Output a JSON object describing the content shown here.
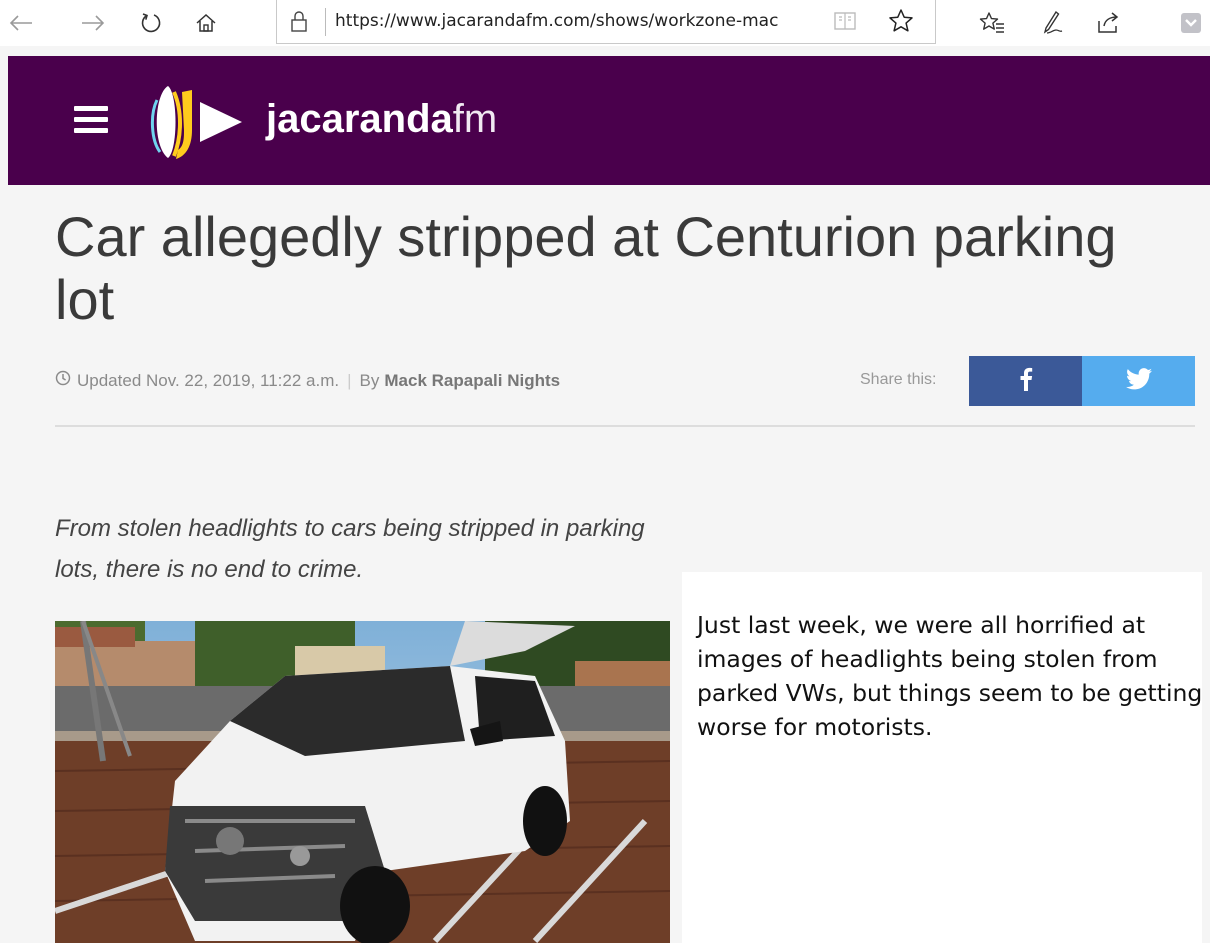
{
  "browser": {
    "url": "https://www.jacarandafm.com/shows/workzone-mac",
    "icons": [
      "back-icon",
      "forward-icon",
      "refresh-icon",
      "home-icon",
      "lock-icon",
      "reading-view-icon",
      "favorite-star-icon",
      "favorites-list-icon",
      "web-note-icon",
      "share-icon",
      "pocket-icon"
    ]
  },
  "site": {
    "logo_bold": "jacaranda",
    "logo_light": "fm",
    "brand_color": "#4a004c"
  },
  "article": {
    "title": "Car allegedly stripped at Centurion parking lot",
    "updated": "Updated Nov. 22, 2019, 11:22 a.m.",
    "separator": "|",
    "by": "By",
    "author": "Mack Rapapali Nights",
    "share_label": "Share this:",
    "intro": "From stolen headlights to cars being stripped in parking lots, there is no end to crime.",
    "body": "Just last week, we were all horrified at images of headlights being stolen from parked VWs, but things seem to be getting worse for motorists."
  },
  "colors": {
    "facebook": "#3b5998",
    "twitter": "#55acee"
  }
}
